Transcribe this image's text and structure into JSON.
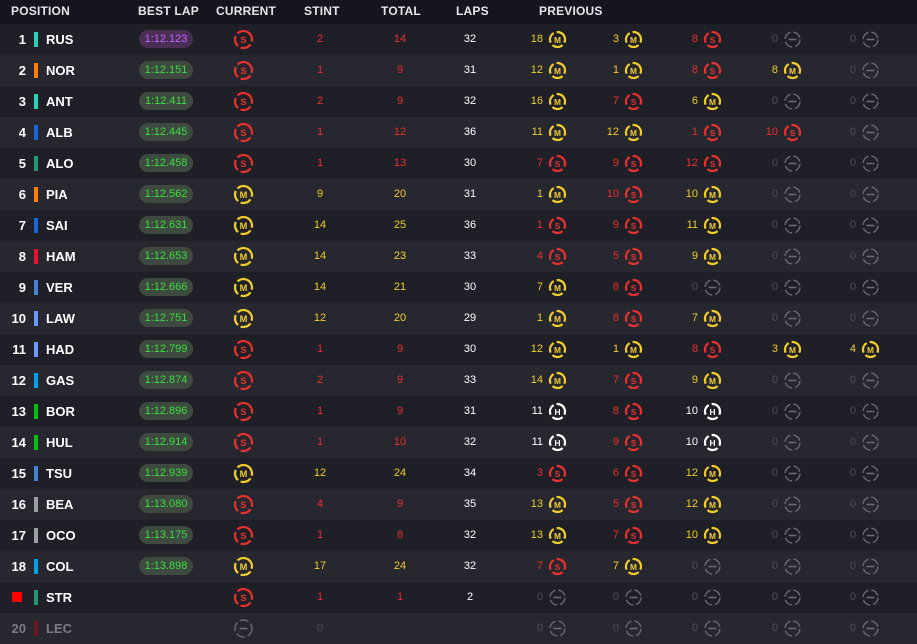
{
  "header": {
    "position": "POSITION",
    "best_lap": "BEST LAP",
    "current": "CURRENT",
    "stint": "STINT",
    "total": "TOTAL",
    "laps": "LAPS",
    "previous": "PREVIOUS"
  },
  "colors": {
    "soft": "#e8312e",
    "medium": "#f1cd2a",
    "hard": "#ffffff",
    "none": "#6a6a72",
    "stint_soft": "#e8312e",
    "stint_medium": "#f1cd2a",
    "best_lap_purple": "#c760ff",
    "lap_green": "#3ddc42"
  },
  "rows": [
    {
      "pos": "1",
      "driver": "RUS",
      "team_color": "#27d3b4",
      "best_lap": "1:12.123",
      "fastest": true,
      "current": "S",
      "stint": "2",
      "total": "14",
      "laps": "32",
      "previous": [
        {
          "n": "18",
          "t": "M"
        },
        {
          "n": "3",
          "t": "M"
        },
        {
          "n": "8",
          "t": "S"
        },
        {
          "n": "0",
          "t": "-"
        },
        {
          "n": "0",
          "t": "-"
        }
      ]
    },
    {
      "pos": "2",
      "driver": "NOR",
      "team_color": "#ff8000",
      "best_lap": "1:12.151",
      "current": "S",
      "stint": "1",
      "total": "9",
      "laps": "31",
      "previous": [
        {
          "n": "12",
          "t": "M"
        },
        {
          "n": "1",
          "t": "M"
        },
        {
          "n": "8",
          "t": "S"
        },
        {
          "n": "8",
          "t": "M"
        },
        {
          "n": "0",
          "t": "-"
        }
      ]
    },
    {
      "pos": "3",
      "driver": "ANT",
      "team_color": "#27d3b4",
      "best_lap": "1:12.411",
      "current": "S",
      "stint": "2",
      "total": "9",
      "laps": "32",
      "previous": [
        {
          "n": "16",
          "t": "M"
        },
        {
          "n": "7",
          "t": "S"
        },
        {
          "n": "6",
          "t": "M"
        },
        {
          "n": "0",
          "t": "-"
        },
        {
          "n": "0",
          "t": "-"
        }
      ]
    },
    {
      "pos": "4",
      "driver": "ALB",
      "team_color": "#1868db",
      "best_lap": "1:12.445",
      "current": "S",
      "stint": "1",
      "total": "12",
      "laps": "36",
      "previous": [
        {
          "n": "11",
          "t": "M"
        },
        {
          "n": "12",
          "t": "M"
        },
        {
          "n": "1",
          "t": "S"
        },
        {
          "n": "10",
          "t": "S"
        },
        {
          "n": "0",
          "t": "-"
        }
      ]
    },
    {
      "pos": "5",
      "driver": "ALO",
      "team_color": "#229971",
      "best_lap": "1:12.458",
      "current": "S",
      "stint": "1",
      "total": "13",
      "laps": "30",
      "previous": [
        {
          "n": "7",
          "t": "S"
        },
        {
          "n": "9",
          "t": "S"
        },
        {
          "n": "12",
          "t": "S"
        },
        {
          "n": "0",
          "t": "-"
        },
        {
          "n": "0",
          "t": "-"
        }
      ]
    },
    {
      "pos": "6",
      "driver": "PIA",
      "team_color": "#ff8000",
      "best_lap": "1:12.562",
      "current": "M",
      "stint": "9",
      "total": "20",
      "laps": "31",
      "previous": [
        {
          "n": "1",
          "t": "M"
        },
        {
          "n": "10",
          "t": "S"
        },
        {
          "n": "10",
          "t": "M"
        },
        {
          "n": "0",
          "t": "-"
        },
        {
          "n": "0",
          "t": "-"
        }
      ]
    },
    {
      "pos": "7",
      "driver": "SAI",
      "team_color": "#1868db",
      "best_lap": "1:12.631",
      "current": "M",
      "stint": "14",
      "total": "25",
      "laps": "36",
      "previous": [
        {
          "n": "1",
          "t": "S"
        },
        {
          "n": "9",
          "t": "S"
        },
        {
          "n": "11",
          "t": "M"
        },
        {
          "n": "0",
          "t": "-"
        },
        {
          "n": "0",
          "t": "-"
        }
      ]
    },
    {
      "pos": "8",
      "driver": "HAM",
      "team_color": "#ed1131",
      "best_lap": "1:12.653",
      "current": "M",
      "stint": "14",
      "total": "23",
      "laps": "33",
      "previous": [
        {
          "n": "4",
          "t": "S"
        },
        {
          "n": "5",
          "t": "S"
        },
        {
          "n": "9",
          "t": "M"
        },
        {
          "n": "0",
          "t": "-"
        },
        {
          "n": "0",
          "t": "-"
        }
      ]
    },
    {
      "pos": "9",
      "driver": "VER",
      "team_color": "#4781d7",
      "best_lap": "1:12.666",
      "current": "M",
      "stint": "14",
      "total": "21",
      "laps": "30",
      "previous": [
        {
          "n": "7",
          "t": "M"
        },
        {
          "n": "8",
          "t": "S"
        },
        {
          "n": "0",
          "t": "-"
        },
        {
          "n": "0",
          "t": "-"
        },
        {
          "n": "0",
          "t": "-"
        }
      ]
    },
    {
      "pos": "10",
      "driver": "LAW",
      "team_color": "#6c98ff",
      "best_lap": "1:12.751",
      "current": "M",
      "stint": "12",
      "total": "20",
      "laps": "29",
      "previous": [
        {
          "n": "1",
          "t": "M"
        },
        {
          "n": "8",
          "t": "S"
        },
        {
          "n": "7",
          "t": "M"
        },
        {
          "n": "0",
          "t": "-"
        },
        {
          "n": "0",
          "t": "-"
        }
      ]
    },
    {
      "pos": "11",
      "driver": "HAD",
      "team_color": "#6c98ff",
      "best_lap": "1:12.799",
      "current": "S",
      "stint": "1",
      "total": "9",
      "laps": "30",
      "previous": [
        {
          "n": "12",
          "t": "M"
        },
        {
          "n": "1",
          "t": "M"
        },
        {
          "n": "8",
          "t": "S"
        },
        {
          "n": "3",
          "t": "M"
        },
        {
          "n": "4",
          "t": "M"
        }
      ]
    },
    {
      "pos": "12",
      "driver": "GAS",
      "team_color": "#00a1e8",
      "best_lap": "1:12.874",
      "current": "S",
      "stint": "2",
      "total": "9",
      "laps": "33",
      "previous": [
        {
          "n": "14",
          "t": "M"
        },
        {
          "n": "7",
          "t": "S"
        },
        {
          "n": "9",
          "t": "M"
        },
        {
          "n": "0",
          "t": "-"
        },
        {
          "n": "0",
          "t": "-"
        }
      ]
    },
    {
      "pos": "13",
      "driver": "BOR",
      "team_color": "#01c00e",
      "best_lap": "1:12.896",
      "current": "S",
      "stint": "1",
      "total": "9",
      "laps": "31",
      "previous": [
        {
          "n": "11",
          "t": "H"
        },
        {
          "n": "8",
          "t": "S"
        },
        {
          "n": "10",
          "t": "H"
        },
        {
          "n": "0",
          "t": "-"
        },
        {
          "n": "0",
          "t": "-"
        }
      ]
    },
    {
      "pos": "14",
      "driver": "HUL",
      "team_color": "#01c00e",
      "best_lap": "1:12.914",
      "current": "S",
      "stint": "1",
      "total": "10",
      "laps": "32",
      "previous": [
        {
          "n": "11",
          "t": "H"
        },
        {
          "n": "9",
          "t": "S"
        },
        {
          "n": "10",
          "t": "H"
        },
        {
          "n": "0",
          "t": "-"
        },
        {
          "n": "0",
          "t": "-"
        }
      ]
    },
    {
      "pos": "15",
      "driver": "TSU",
      "team_color": "#4781d7",
      "best_lap": "1:12.939",
      "current": "M",
      "stint": "12",
      "total": "24",
      "laps": "34",
      "previous": [
        {
          "n": "3",
          "t": "S"
        },
        {
          "n": "6",
          "t": "S"
        },
        {
          "n": "12",
          "t": "M"
        },
        {
          "n": "0",
          "t": "-"
        },
        {
          "n": "0",
          "t": "-"
        }
      ]
    },
    {
      "pos": "16",
      "driver": "BEA",
      "team_color": "#9c9fa2",
      "best_lap": "1:13.080",
      "current": "S",
      "stint": "4",
      "total": "9",
      "laps": "35",
      "previous": [
        {
          "n": "13",
          "t": "M"
        },
        {
          "n": "5",
          "t": "S"
        },
        {
          "n": "12",
          "t": "M"
        },
        {
          "n": "0",
          "t": "-"
        },
        {
          "n": "0",
          "t": "-"
        }
      ]
    },
    {
      "pos": "17",
      "driver": "OCO",
      "team_color": "#9c9fa2",
      "best_lap": "1:13.175",
      "current": "S",
      "stint": "1",
      "total": "8",
      "laps": "32",
      "previous": [
        {
          "n": "13",
          "t": "M"
        },
        {
          "n": "7",
          "t": "S"
        },
        {
          "n": "10",
          "t": "M"
        },
        {
          "n": "0",
          "t": "-"
        },
        {
          "n": "0",
          "t": "-"
        }
      ]
    },
    {
      "pos": "18",
      "driver": "COL",
      "team_color": "#00a1e8",
      "best_lap": "1:13.898",
      "current": "M",
      "stint": "17",
      "total": "24",
      "laps": "32",
      "previous": [
        {
          "n": "7",
          "t": "S"
        },
        {
          "n": "7",
          "t": "M"
        },
        {
          "n": "0",
          "t": "-"
        },
        {
          "n": "0",
          "t": "-"
        },
        {
          "n": "0",
          "t": "-"
        }
      ]
    },
    {
      "pos": "",
      "driver": "STR",
      "team_color": "#229971",
      "best_lap": "",
      "retired_flag": true,
      "current": "S",
      "stint": "1",
      "total": "1",
      "laps": "2",
      "previous": [
        {
          "n": "0",
          "t": "-"
        },
        {
          "n": "0",
          "t": "-"
        },
        {
          "n": "0",
          "t": "-"
        },
        {
          "n": "0",
          "t": "-"
        },
        {
          "n": "0",
          "t": "-"
        }
      ]
    },
    {
      "pos": "20",
      "driver": "LEC",
      "team_color": "#6e1420",
      "best_lap": "",
      "dim": true,
      "current": "-",
      "stint": "0",
      "total": "",
      "laps": "",
      "previous": [
        {
          "n": "0",
          "t": "-"
        },
        {
          "n": "0",
          "t": "-"
        },
        {
          "n": "0",
          "t": "-"
        },
        {
          "n": "0",
          "t": "-"
        },
        {
          "n": "0",
          "t": "-"
        }
      ]
    }
  ]
}
